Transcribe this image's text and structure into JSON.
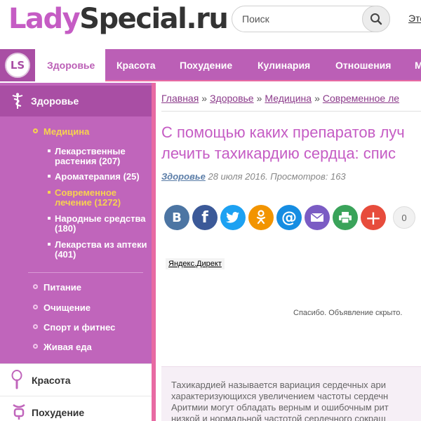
{
  "header": {
    "logo_part1": "Lady",
    "logo_part2": "Special",
    "logo_part3": ".ru",
    "search_placeholder": "Поиск",
    "top_link": "Эте"
  },
  "nav": {
    "logo_text": "LS",
    "items": [
      {
        "label": "Здоровье",
        "active": true
      },
      {
        "label": "Красота"
      },
      {
        "label": "Похудение"
      },
      {
        "label": "Кулинария"
      },
      {
        "label": "Отношения"
      },
      {
        "label": "М"
      }
    ]
  },
  "sidebar": {
    "section_title": "Здоровье",
    "items": [
      {
        "label": "Медицина",
        "active": true
      },
      {
        "label": "Питание"
      },
      {
        "label": "Очищение"
      },
      {
        "label": "Спорт и фитнес"
      },
      {
        "label": "Живая еда"
      }
    ],
    "subitems": [
      {
        "label": "Лекарственные растения (207)"
      },
      {
        "label": "Ароматерапия (25)"
      },
      {
        "label": "Современное лечение (1272)",
        "active": true
      },
      {
        "label": "Народные средства (180)"
      },
      {
        "label": "Лекарства из аптеки (401)"
      }
    ],
    "categories": [
      {
        "label": "Красота",
        "icon": "mirror-icon"
      },
      {
        "label": "Похудение",
        "icon": "scale-icon"
      }
    ]
  },
  "main": {
    "breadcrumbs": [
      "Главная",
      "Здоровье",
      "Медицина",
      "Современное ле"
    ],
    "breadcrumb_sep": "»",
    "title_line1": "С помощью каких препаратов луч",
    "title_line2": "лечить тахикардию сердца: спис",
    "meta_category": "Здоровье",
    "meta_text": "28 июля 2016. Просмотров: 163",
    "share_count": "0",
    "shares": [
      {
        "name": "vk",
        "glyph": "B",
        "color": "#4c75a3"
      },
      {
        "name": "facebook",
        "glyph": "f",
        "color": "#3b5998"
      },
      {
        "name": "twitter",
        "glyph": "t",
        "color": "#1da1f2"
      },
      {
        "name": "odnoklassniki",
        "glyph": "ok",
        "color": "#f29400"
      },
      {
        "name": "mailru",
        "glyph": "@",
        "color": "#168de2"
      },
      {
        "name": "email",
        "glyph": "✉",
        "color": "#7b5cc4"
      },
      {
        "name": "print",
        "glyph": "⎙",
        "color": "#3aa35a"
      },
      {
        "name": "more",
        "glyph": "+",
        "color": "#e74c3c"
      }
    ],
    "yandex_label": "Яндекс.Директ",
    "ad_hidden_text": "Спасибо. Объявление скрыто.",
    "article_lines": [
      "Тахикардией называется вариация сердечных ари",
      "характеризующихся увеличением частоты сердечн",
      "Аритмии могут обладать верным и ошибочным рит",
      "низкой и нормальной частотой сердечного сокращ"
    ]
  }
}
